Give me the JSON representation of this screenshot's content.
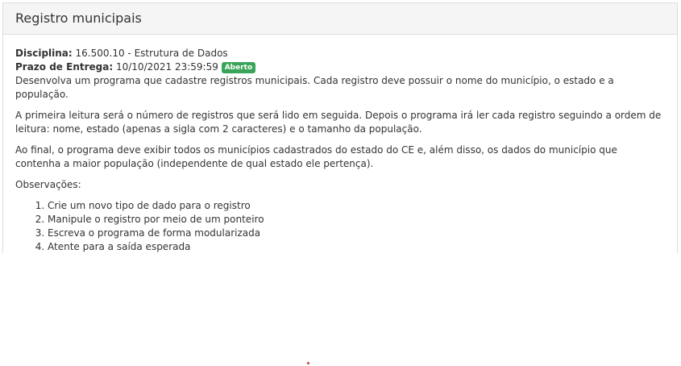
{
  "header": {
    "title": "Registro municipais"
  },
  "meta": {
    "disciplina_label": "Disciplina:",
    "disciplina_value": "16.500.10 - Estrutura de Dados",
    "prazo_label": "Prazo de Entrega:",
    "prazo_value": "10/10/2021 23:59:59",
    "status_badge": "Aberto"
  },
  "description": {
    "paragraphs": [
      "Desenvolva um programa que cadastre registros municipais. Cada registro deve possuir o nome do município, o estado e a população.",
      "A primeira leitura será o número de registros que será lido em seguida. Depois o programa irá ler cada registro seguindo a ordem de leitura: nome, estado (apenas a sigla com 2 caracteres) e o tamanho da população.",
      "Ao final, o programa deve exibir todos os municípios cadastrados do estado do CE e, além disso, os dados do município que contenha a maior população (independente de qual estado ele pertença).",
      "Observações:"
    ],
    "observations": [
      "Crie um novo tipo de dado para o registro",
      "Manipule o registro por meio de um ponteiro",
      "Escreva o programa de forma modularizada",
      "Atente para a saída esperada"
    ]
  },
  "colors": {
    "badge": "#3aa55a",
    "heading_bg": "#f5f5f5",
    "dot": "#d0343c"
  }
}
